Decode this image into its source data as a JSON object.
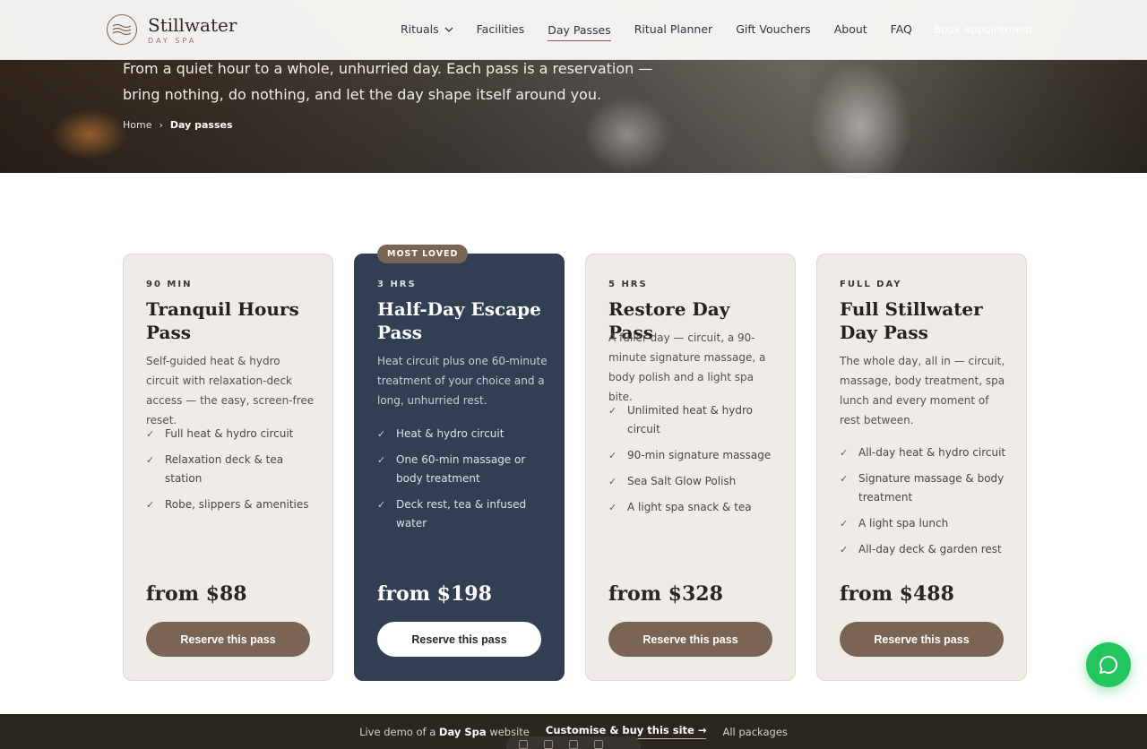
{
  "header": {
    "brand_name": "Stillwater",
    "brand_tag": "DAY SPA",
    "nav": [
      {
        "label": "Rituals",
        "has_dropdown": true
      },
      {
        "label": "Facilities"
      },
      {
        "label": "Day Passes",
        "active": true
      },
      {
        "label": "Ritual Planner"
      },
      {
        "label": "Gift Vouchers"
      },
      {
        "label": "About"
      },
      {
        "label": "FAQ"
      }
    ],
    "book_label": "Book appointment"
  },
  "hero": {
    "subtitle": "From a quiet hour to a whole, unhurried day. Each pass is a reservation — bring nothing, do nothing, and let the day shape itself around you.",
    "breadcrumb": {
      "home": "Home",
      "separator": "›",
      "current": "Day passes"
    }
  },
  "cards": [
    {
      "duration": "90 MIN",
      "title": "Tranquil Hours Pass",
      "description": "Self-guided heat & hydro circuit with relaxation-deck access — the easy, screen-free reset.",
      "features": [
        "Full heat & hydro circuit",
        "Relaxation deck & tea station",
        "Robe, slippers & amenities"
      ],
      "price": "from $88",
      "cta": "Reserve this pass"
    },
    {
      "badge": "MOST LOVED",
      "duration": "3 HRS",
      "title": "Half-Day Escape Pass",
      "description": "Heat circuit plus one 60-minute treatment of your choice and a long, unhurried rest.",
      "features": [
        "Heat & hydro circuit",
        "One 60-min massage or body treatment",
        "Deck rest, tea & infused water"
      ],
      "price": "from $198",
      "cta": "Reserve this pass"
    },
    {
      "duration": "5 HRS",
      "title": "Restore Day Pass",
      "description": "A fuller day — circuit, a 90-minute signature massage, a body polish and a light spa bite.",
      "features": [
        "Unlimited heat & hydro circuit",
        "90-min signature massage",
        "Sea Salt Glow Polish",
        "A light spa snack & tea"
      ],
      "price": "from $328",
      "cta": "Reserve this pass"
    },
    {
      "duration": "FULL DAY",
      "title": "Full Stillwater Day Pass",
      "description": "The whole day, all in — circuit, massage, body treatment, spa lunch and every moment of rest between.",
      "features": [
        "All-day heat & hydro circuit",
        "Signature massage & body treatment",
        "A light spa lunch",
        "All-day deck & garden rest"
      ],
      "price": "from $488",
      "cta": "Reserve this pass"
    }
  ],
  "footer_bar": {
    "demo_prefix": "Live demo of a",
    "demo_strong": "Day Spa",
    "demo_suffix": "website",
    "customise": "Customise & buy this site →",
    "packages": "All packages"
  },
  "colors": {
    "accent": "#7a6554",
    "featured_bg": "#323f52",
    "card_bg": "#efece7",
    "chat": "#22c55e",
    "bottom_bar": "#2c2621"
  }
}
